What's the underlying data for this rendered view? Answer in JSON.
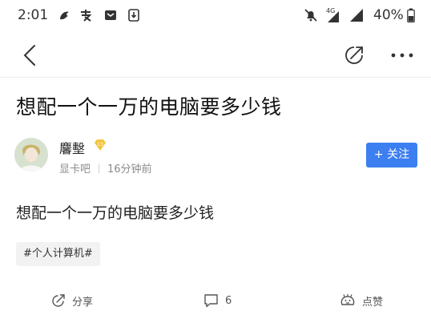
{
  "status_bar": {
    "time": "2:01",
    "battery_percent": "40%",
    "network_label": "4G",
    "icons": [
      "squirrel-app-icon",
      "alipay-icon",
      "message-icon",
      "download-icon",
      "mute-bell-icon",
      "signal-icon",
      "battery-icon"
    ]
  },
  "nav": {
    "back_icon": "chevron-left-icon",
    "share_icon": "share-arrow-icon",
    "more_icon": "more-dots-icon"
  },
  "post": {
    "title": "想配一个一万的电脑要多少钱",
    "author": {
      "name": "麘墼",
      "level": "13",
      "forum": "显卡吧",
      "time_ago": "16分钟前"
    },
    "follow_label": "+ 关注",
    "content": "想配一个一万的电脑要多少钱",
    "tag": "#个人计算机#"
  },
  "actions": {
    "share_label": "分享",
    "comment_count": "6",
    "like_label": "点赞"
  },
  "colors": {
    "accent": "#3c7ff0",
    "badge": "#f3c43a"
  }
}
